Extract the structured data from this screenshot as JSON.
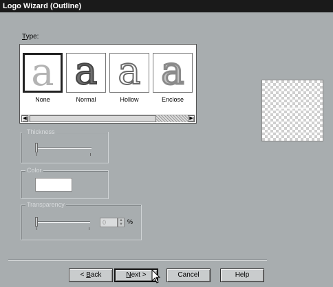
{
  "window": {
    "title": "Logo Wizard (Outline)"
  },
  "type_section": {
    "label_prefix": "",
    "label_accel": "T",
    "label_rest": "ype:",
    "options": [
      {
        "glyph": "a",
        "caption": "None",
        "selected": true
      },
      {
        "glyph": "a",
        "caption": "Normal",
        "selected": false
      },
      {
        "glyph": "a",
        "caption": "Hollow",
        "selected": false
      },
      {
        "glyph": "a",
        "caption": "Enclose",
        "selected": false
      }
    ]
  },
  "thickness": {
    "title": "Thickness"
  },
  "color": {
    "title": "Color",
    "value": "#ffffff"
  },
  "transparency": {
    "title": "Transparency",
    "value": "0",
    "unit": "%"
  },
  "buttons": {
    "back_accel": "B",
    "back_prefix": "< ",
    "back_rest": "ack",
    "next_accel": "N",
    "next_rest": "ext >",
    "cancel": "Cancel",
    "help": "Help"
  },
  "icons": {
    "arrow_left": "scroll-left-icon",
    "arrow_right": "scroll-right-icon",
    "spin_up": "spin-up-icon",
    "spin_down": "spin-down-icon",
    "cursor": "mouse-pointer-icon"
  }
}
